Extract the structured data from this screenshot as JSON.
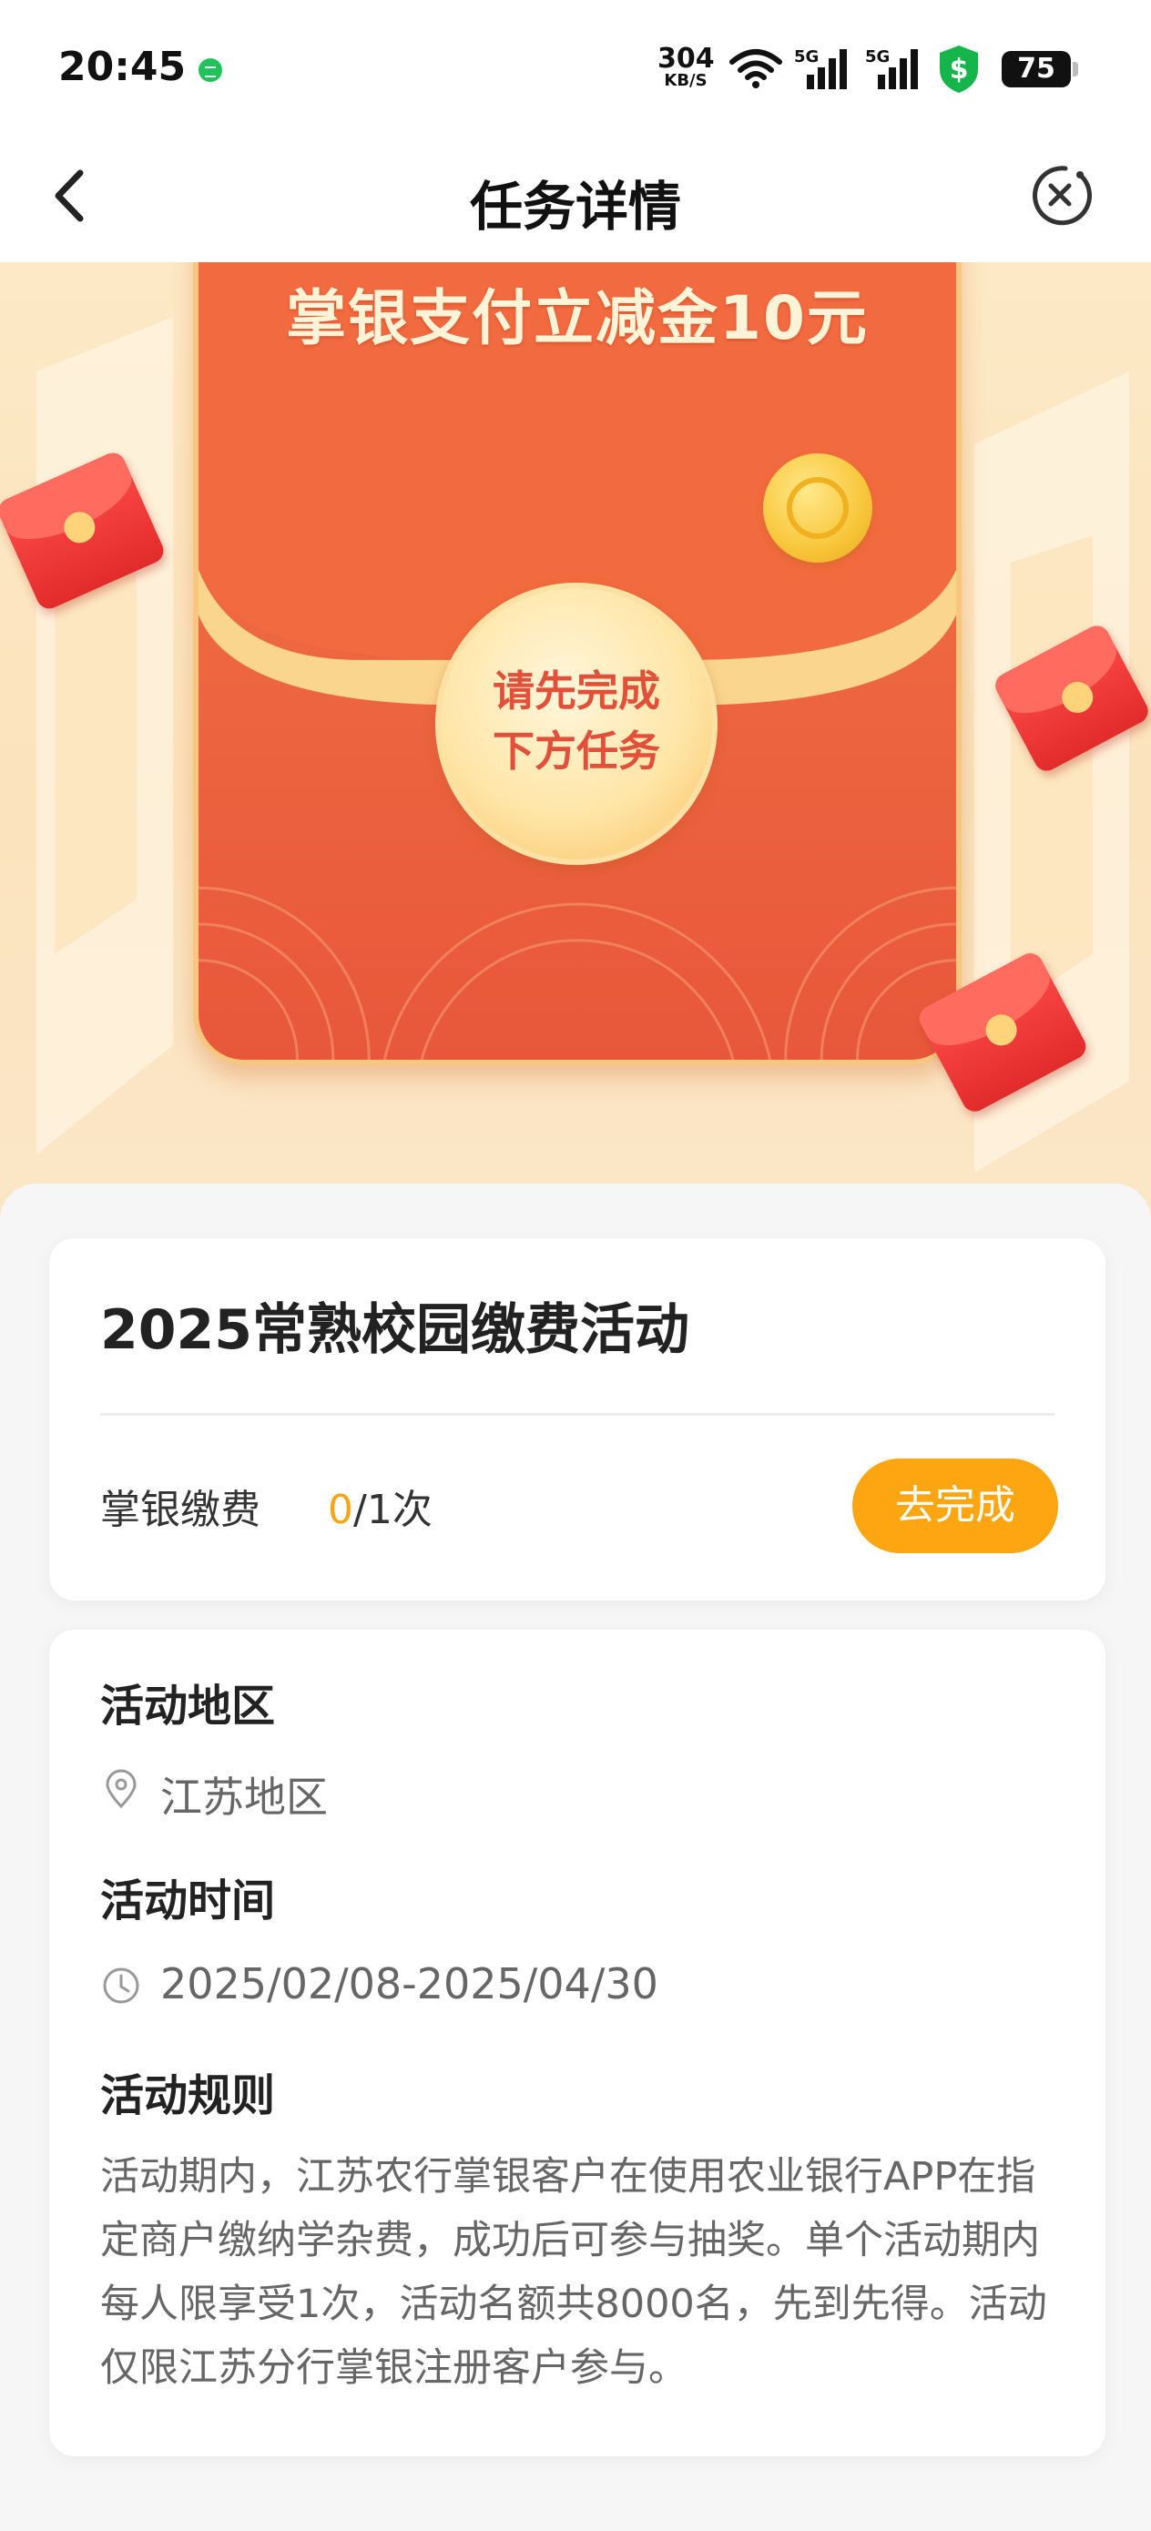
{
  "status_bar": {
    "time": "20:45",
    "net_speed_value": "304",
    "net_speed_unit": "KB/S",
    "signal_1_label": "5G",
    "signal_2_label": "5G",
    "battery": "75"
  },
  "nav": {
    "title": "任务详情"
  },
  "banner": {
    "title": "掌银支付立减金10元",
    "seal_line1": "请先完成",
    "seal_line2": "下方任务"
  },
  "activity": {
    "title": "2025常熟校园缴费活动",
    "task_name": "掌银缴费",
    "progress_done": "0",
    "progress_total": "/1次",
    "button_label": "去完成"
  },
  "details": {
    "region_label": "活动地区",
    "region_value": "江苏地区",
    "time_label": "活动时间",
    "time_value": "2025/02/08-2025/04/30",
    "rules_label": "活动规则",
    "rules_text": "活动期内，江苏农行掌银客户在使用农业银行APP在指定商户缴纳学杂费，成功后可参与抽奖。单个活动期内每人限享受1次，活动名额共8000名，先到先得。活动仅限江苏分行掌银注册客户参与。"
  },
  "colors": {
    "accent": "#fea512",
    "progress_done": "#f6a614",
    "envelope_red": "#ee6a42",
    "seal_text": "#e2503a"
  },
  "icons": [
    "chevron-left-icon",
    "close-circle-icon",
    "location-pin-icon",
    "clock-icon",
    "wifi-icon",
    "signal-icon",
    "shield-dollar-icon",
    "message-icon"
  ]
}
